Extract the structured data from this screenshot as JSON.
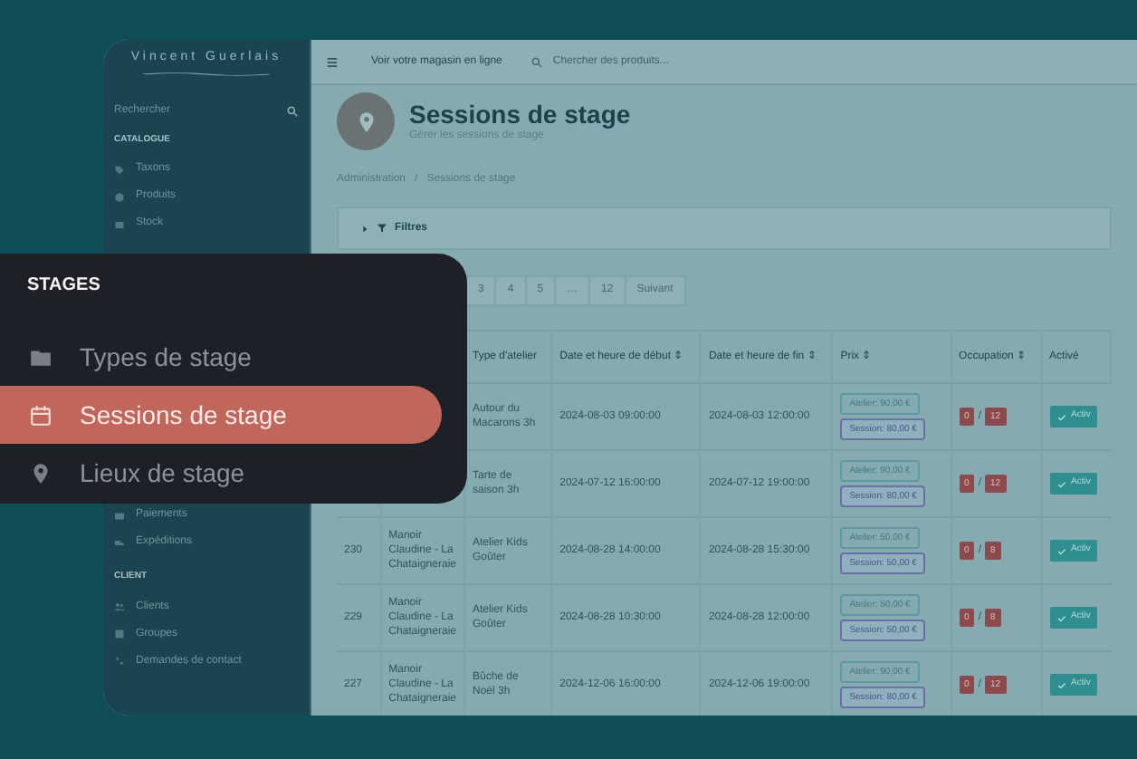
{
  "sidebar": {
    "brand": "Vincent Guerlais",
    "search": {
      "placeholder": "Rechercher"
    },
    "sections": [
      {
        "title": "CATALOGUE",
        "items": [
          {
            "label": "Taxons"
          },
          {
            "label": "Produits"
          },
          {
            "label": "Stock"
          }
        ]
      },
      {
        "items": [
          {
            "label": "Paiements"
          },
          {
            "label": "Expéditions"
          }
        ]
      },
      {
        "title": "CLIENT",
        "items": [
          {
            "label": "Clients"
          },
          {
            "label": "Groupes"
          },
          {
            "label": "Demandes de contact"
          }
        ]
      }
    ]
  },
  "topbar": {
    "shop_link": "Voir votre magasin en ligne",
    "search": {
      "placeholder": "Chercher des produits..."
    }
  },
  "header": {
    "title": "Sessions de stage",
    "subtitle": "Gérer les sessions de stage"
  },
  "breadcrumb": {
    "items": [
      "Administration",
      "Sessions de stage"
    ],
    "separator": "/"
  },
  "filters": {
    "label": "Filtres",
    "expanded": false
  },
  "pagination": [
    "3",
    "4",
    "5",
    "…",
    "12",
    "Suivant"
  ],
  "table": {
    "columns": [
      "Type d'atelier",
      "Date et heure de début ⇕",
      "Date et heure de fin ⇕",
      "Prix ⇕",
      "Occupation ⇕",
      "Activé"
    ],
    "rows": [
      {
        "type": "Autour du Macarons 3h",
        "start": "2024-08-03 09:00:00",
        "end": "2024-08-03 12:00:00",
        "prices": [
          "Atelier: 90,00 €",
          "Session: 80,00 €"
        ],
        "occupied": "0",
        "separator": "/",
        "capacity": "12",
        "active": "Activ"
      },
      {
        "type": "Tarte de saison 3h",
        "start": "2024-07-12 16:00:00",
        "end": "2024-07-12 19:00:00",
        "prices": [
          "Atelier: 90,00 €",
          "Session: 80,00 €"
        ],
        "occupied": "0",
        "separator": "/",
        "capacity": "12",
        "active": "Activ"
      },
      {
        "id": "230",
        "place": "Manoir Claudine - La Chataigneraie",
        "type": "Atelier Kids Goûter",
        "start": "2024-08-28 14:00:00",
        "end": "2024-08-28 15:30:00",
        "prices": [
          "Atelier: 50,00 €",
          "Session: 50,00 €"
        ],
        "occupied": "0",
        "separator": "/",
        "capacity": "8",
        "active": "Activ"
      },
      {
        "id": "229",
        "place": "Manoir Claudine - La Chataigneraie",
        "type": "Atelier Kids Goûter",
        "start": "2024-08-28 10:30:00",
        "end": "2024-08-28 12:00:00",
        "prices": [
          "Atelier: 50,00 €",
          "Session: 50,00 €"
        ],
        "occupied": "0",
        "separator": "/",
        "capacity": "8",
        "active": "Activ"
      },
      {
        "id": "227",
        "place": "Manoir Claudine - La Chataigneraie",
        "type": "Bûche de Noël 3h",
        "start": "2024-12-06 16:00:00",
        "end": "2024-12-06 19:00:00",
        "prices": [
          "Atelier: 90,00 €",
          "Session: 80,00 €"
        ],
        "occupied": "0",
        "separator": "/",
        "capacity": "12",
        "active": "Activ"
      }
    ]
  },
  "popup": {
    "title": "STAGES",
    "items": [
      {
        "label": "Types de stage",
        "selected": false
      },
      {
        "label": "Sessions de stage",
        "selected": true
      },
      {
        "label": "Lieux de stage",
        "selected": false
      }
    ]
  }
}
